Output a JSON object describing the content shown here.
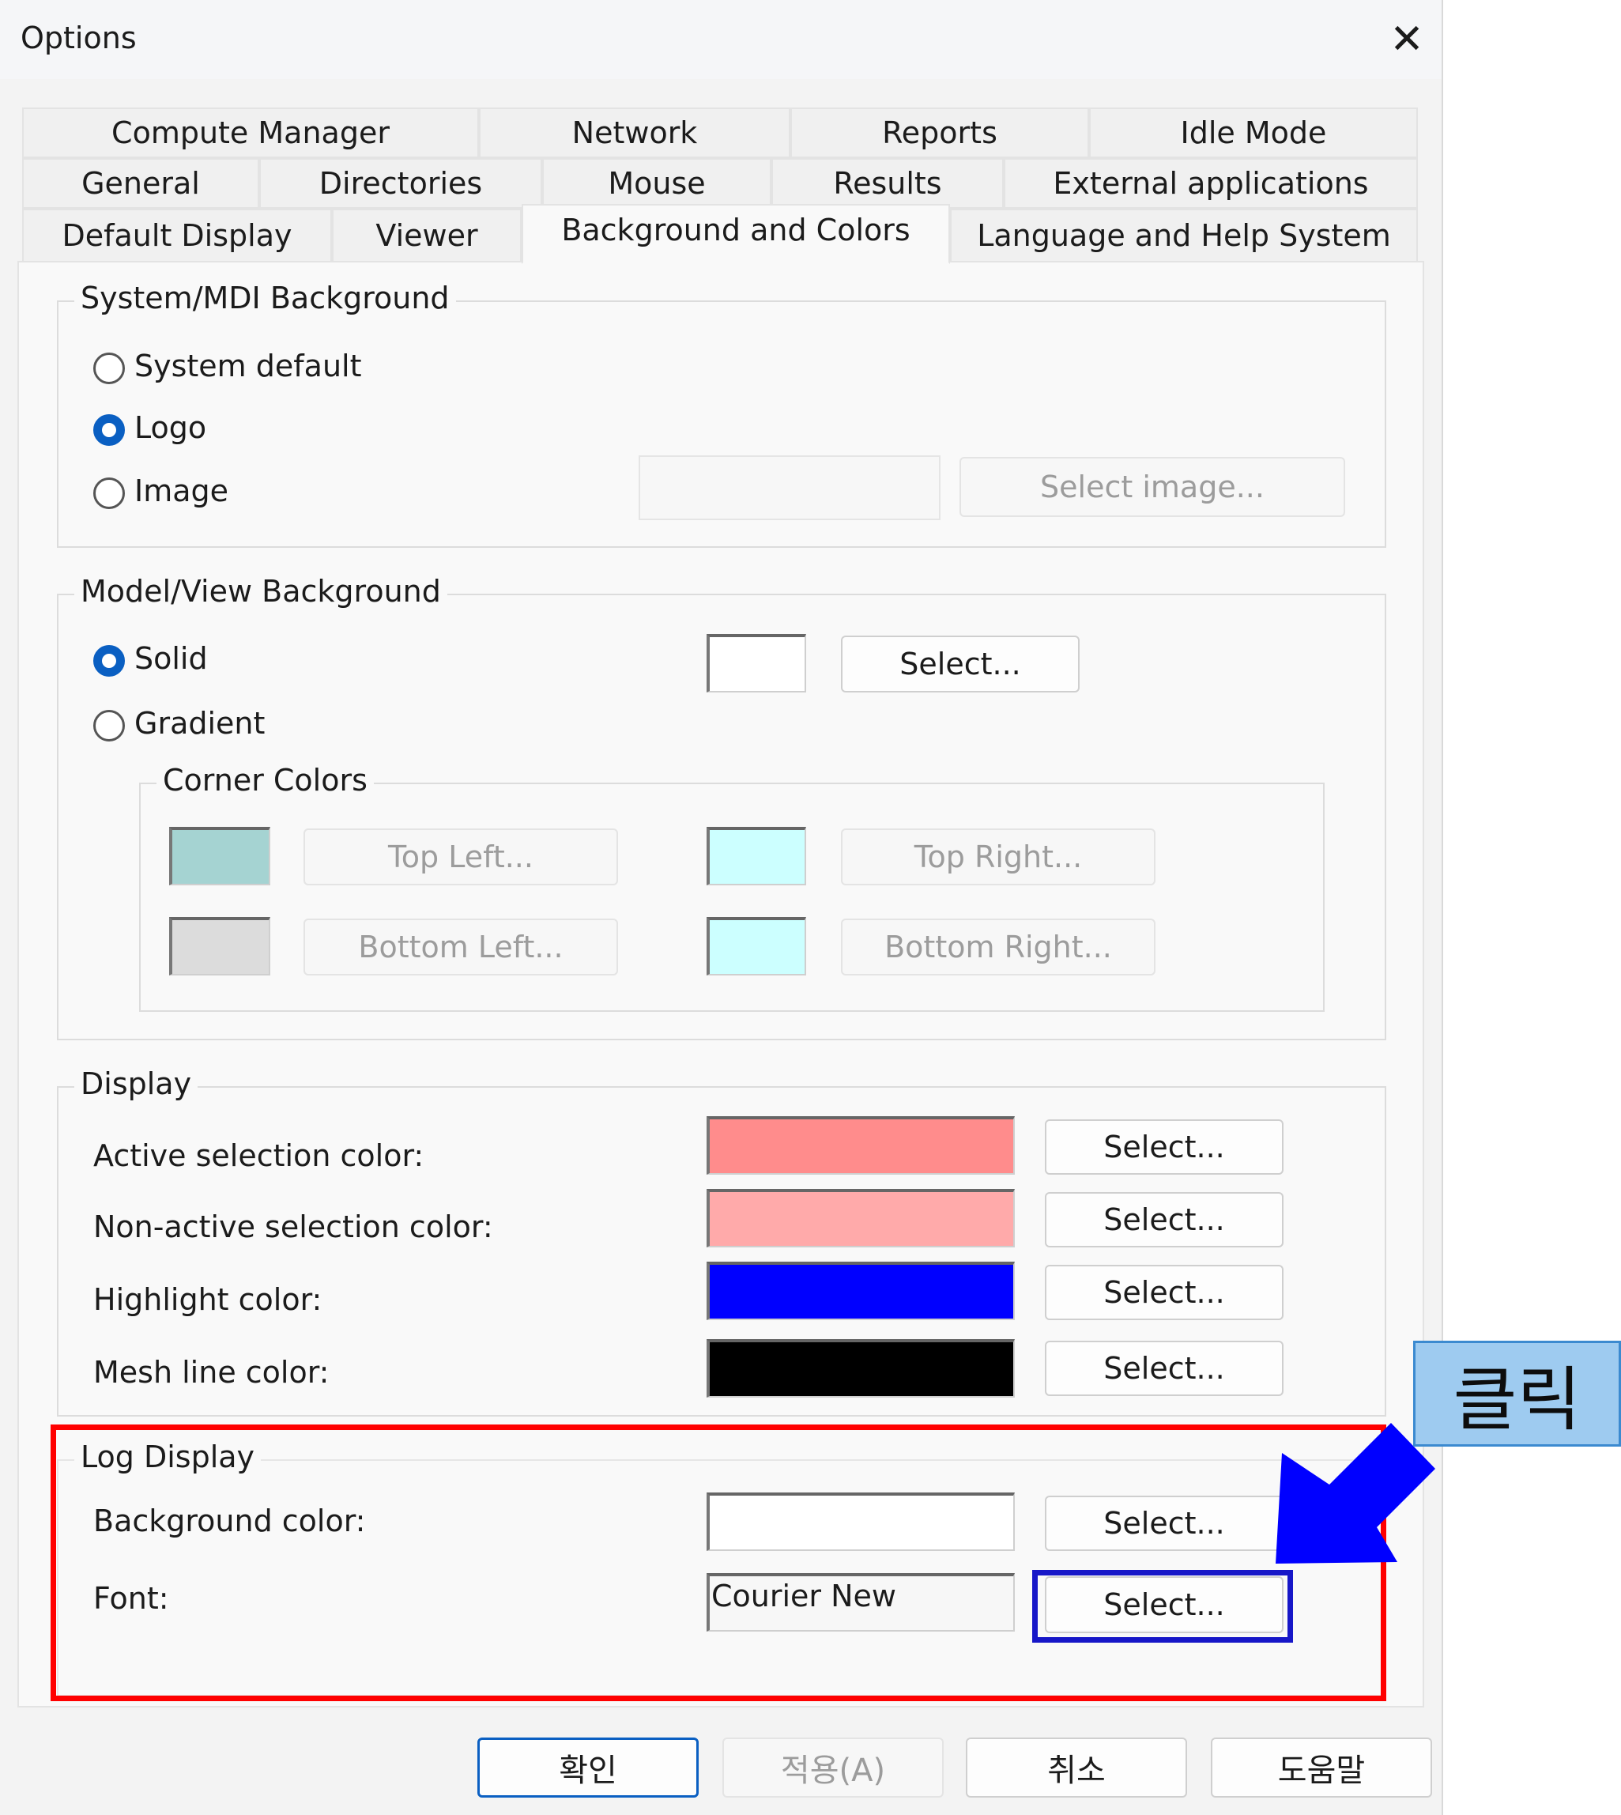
{
  "window": {
    "title": "Options"
  },
  "tabs": {
    "row1": [
      "Compute Manager",
      "Network",
      "Reports",
      "Idle Mode"
    ],
    "row2": [
      "General",
      "Directories",
      "Mouse",
      "Results",
      "External applications"
    ],
    "row3": [
      "Default Display",
      "Viewer",
      "Background and Colors",
      "Language and Help System"
    ],
    "active": "Background and Colors"
  },
  "system_bg": {
    "legend": "System/MDI Background",
    "opt_system_default": "System default",
    "opt_logo": "Logo",
    "opt_image": "Image",
    "selected": "Logo",
    "image_path": "",
    "select_image": "Select image..."
  },
  "model_bg": {
    "legend": "Model/View Background",
    "opt_solid": "Solid",
    "opt_gradient": "Gradient",
    "selected": "Solid",
    "solid_color": "#ffffff",
    "select": "Select...",
    "corner": {
      "legend": "Corner Colors",
      "top_left": "Top Left...",
      "top_right": "Top Right...",
      "bottom_left": "Bottom Left...",
      "bottom_right": "Bottom Right...",
      "top_left_color": "#a5d3d2",
      "top_right_color": "#ccffff",
      "bottom_left_color": "#dcdcdc",
      "bottom_right_color": "#ccffff"
    }
  },
  "display": {
    "legend": "Display",
    "active_label": "Active selection color:",
    "nonactive_label": "Non-active selection color:",
    "highlight_label": "Highlight color:",
    "mesh_label": "Mesh line color:",
    "active_color": "#ff8c8c",
    "nonactive_color": "#ffaaaa",
    "highlight_color": "#0000ff",
    "mesh_color": "#000000",
    "select": "Select..."
  },
  "log": {
    "legend": "Log Display",
    "bg_label": "Background color:",
    "font_label": "Font:",
    "bg_color": "#ffffff",
    "font_value": "Courier New",
    "select": "Select..."
  },
  "annotation": {
    "callout": "클릭"
  },
  "footer": {
    "ok": "확인",
    "apply": "적용(A)",
    "cancel": "취소",
    "help": "도움말"
  }
}
